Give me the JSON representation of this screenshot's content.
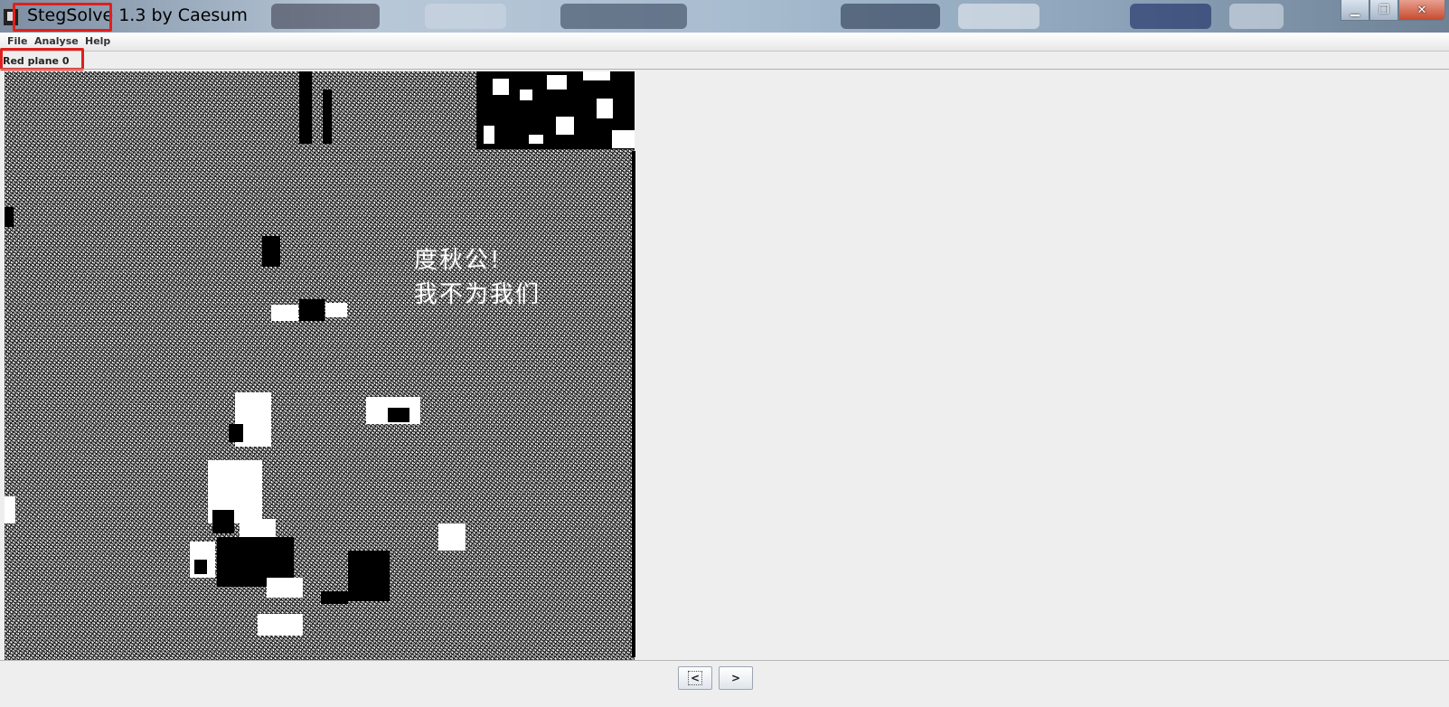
{
  "window": {
    "title": "StegSolve 1.3 by Caesum",
    "minimize_icon": "minimize-icon",
    "maximize_icon": "restore-icon",
    "close_icon": "close-icon"
  },
  "menu": {
    "items": [
      {
        "label": "File"
      },
      {
        "label": "Analyse"
      },
      {
        "label": "Help"
      }
    ]
  },
  "view": {
    "plane_label": "Red plane 0",
    "hidden_text_line1": "度秋公!",
    "hidden_text_line2": "我不为我们"
  },
  "navigation": {
    "prev_label": "<",
    "next_label": ">"
  },
  "colors": {
    "highlight": "#e0201c"
  }
}
